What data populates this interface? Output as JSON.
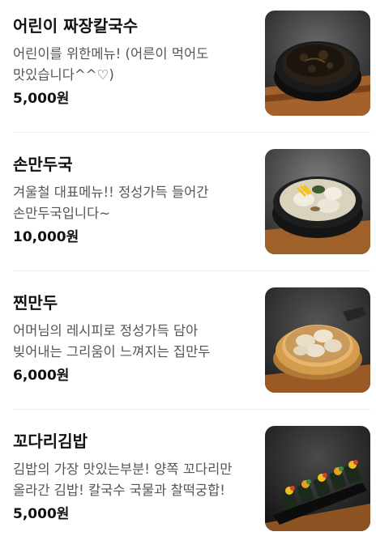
{
  "menu": {
    "items": [
      {
        "name": "어린이 짜장칼국수",
        "description": "어린이를 위한메뉴! (어른이 먹어도 맛있습니다^^♡)",
        "price": "5,000원",
        "image_icon": "jajang-noodle-photo"
      },
      {
        "name": "손만두국",
        "description": "겨울철 대표메뉴!! 정성가득 들어간 손만두국입니다~",
        "price": "10,000원",
        "image_icon": "dumpling-soup-photo"
      },
      {
        "name": "찐만두",
        "description": "어머님의 레시피로 정성가득 담아 빚어내는 그리움이 느껴지는 집만두",
        "price": "6,000원",
        "image_icon": "steamed-dumpling-photo"
      },
      {
        "name": "꼬다리김밥",
        "description": "김밥의 가장 맛있는부분! 양쪽 꼬다리만 올라간 김밥! 칼국수 국물과 찰떡궁합!",
        "price": "5,000원",
        "image_icon": "kimbap-photo"
      }
    ]
  }
}
